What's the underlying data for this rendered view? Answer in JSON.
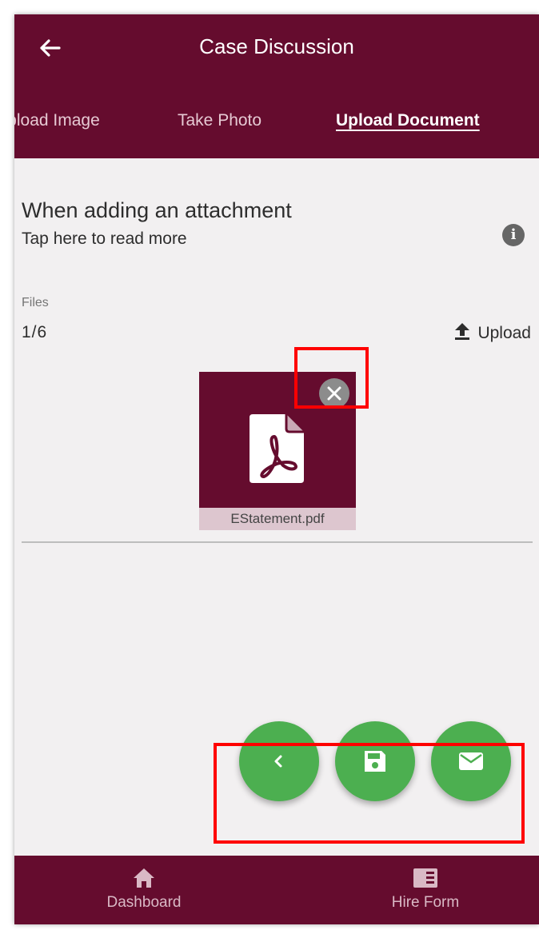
{
  "header": {
    "title": "Case Discussion",
    "back_icon": "arrow-left-icon"
  },
  "tabs": [
    {
      "label": "Upload Image",
      "active": false
    },
    {
      "label": "Take Photo",
      "active": false
    },
    {
      "label": "Upload Document",
      "active": true
    }
  ],
  "info": {
    "heading": "When adding an attachment",
    "subtext": "Tap here to read more",
    "icon": "info-icon"
  },
  "files": {
    "label": "Files",
    "count": "1/6",
    "upload_label": "Upload",
    "items": [
      {
        "name": "EStatement.pdf",
        "icon": "pdf-file-icon"
      }
    ]
  },
  "fabs": [
    {
      "name": "back",
      "icon": "chevron-left-icon"
    },
    {
      "name": "save",
      "icon": "save-icon"
    },
    {
      "name": "email",
      "icon": "envelope-icon"
    }
  ],
  "bottom_nav": [
    {
      "label": "Dashboard",
      "icon": "home-icon"
    },
    {
      "label": "Hire Form",
      "icon": "form-icon"
    }
  ],
  "colors": {
    "primary": "#650c2e",
    "fab": "#4caf50",
    "background": "#f2f0f1",
    "annotation": "#ff0000"
  }
}
